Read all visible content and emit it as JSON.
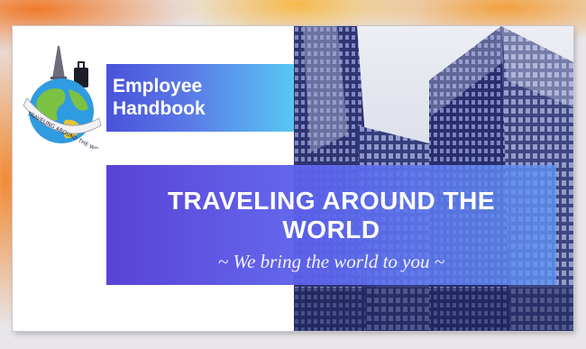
{
  "slide": {
    "handbook_label_line1": "Employee",
    "handbook_label_line2": "Handbook",
    "title_line1": "TRAVELING AROUND THE",
    "title_line2": "WORLD",
    "tagline": "~ We bring the world to you ~"
  },
  "logo": {
    "ring_text": "TRAVELING AROUND THE WORLD"
  },
  "colors": {
    "band_start": "#4a52d9",
    "band_end": "#59c7f2",
    "main_band": "#5a3fd8",
    "backdrop_accent": "#f07a2a"
  },
  "icons": [
    "globe-logo-icon",
    "eiffel-tower-icon",
    "suitcase-icon",
    "city-skyscrapers-photo"
  ]
}
